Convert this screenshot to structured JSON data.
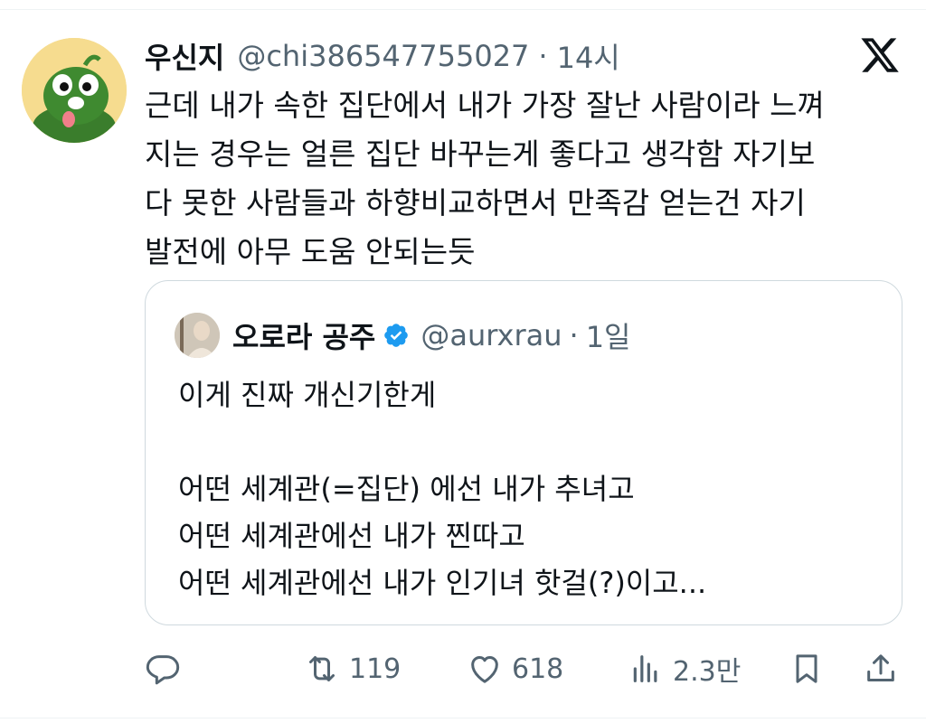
{
  "tweet": {
    "author_name": "우신지",
    "handle": "@chi386547755027",
    "separator": "·",
    "time": "14시",
    "lines": [
      "근데 내가 속한 집단에서 내가 가장 잘난 사람이라 느껴",
      "지는 경우는 얼른 집단 바꾸는게 좋다고 생각함 자기보",
      "다 못한 사람들과 하향비교하면서 만족감 얻는건 자기",
      "발전에 아무 도움 안되는듯"
    ]
  },
  "quote": {
    "author_name": "오로라 공주",
    "handle": "@aurxrau",
    "separator": "·",
    "time": "1일",
    "lines": [
      "이게 진짜 개신기한게",
      "",
      "어떤 세계관(=집단) 에선 내가 추녀고",
      "어떤 세계관에선 내가 찐따고",
      "어떤 세계관에선 내가 인기녀 핫걸(?)이고..."
    ]
  },
  "actions": {
    "reply": {
      "icon": "reply-icon"
    },
    "retweet": {
      "icon": "retweet-icon",
      "count": "119"
    },
    "like": {
      "icon": "heart-icon",
      "count": "618"
    },
    "views": {
      "icon": "views-icon",
      "count": "2.3만"
    },
    "bookmark": {
      "icon": "bookmark-icon"
    },
    "share": {
      "icon": "share-icon"
    }
  },
  "colors": {
    "text": "#0f1419",
    "secondary": "#536471",
    "border": "#cfd9de",
    "verified": "#1d9bf0"
  }
}
